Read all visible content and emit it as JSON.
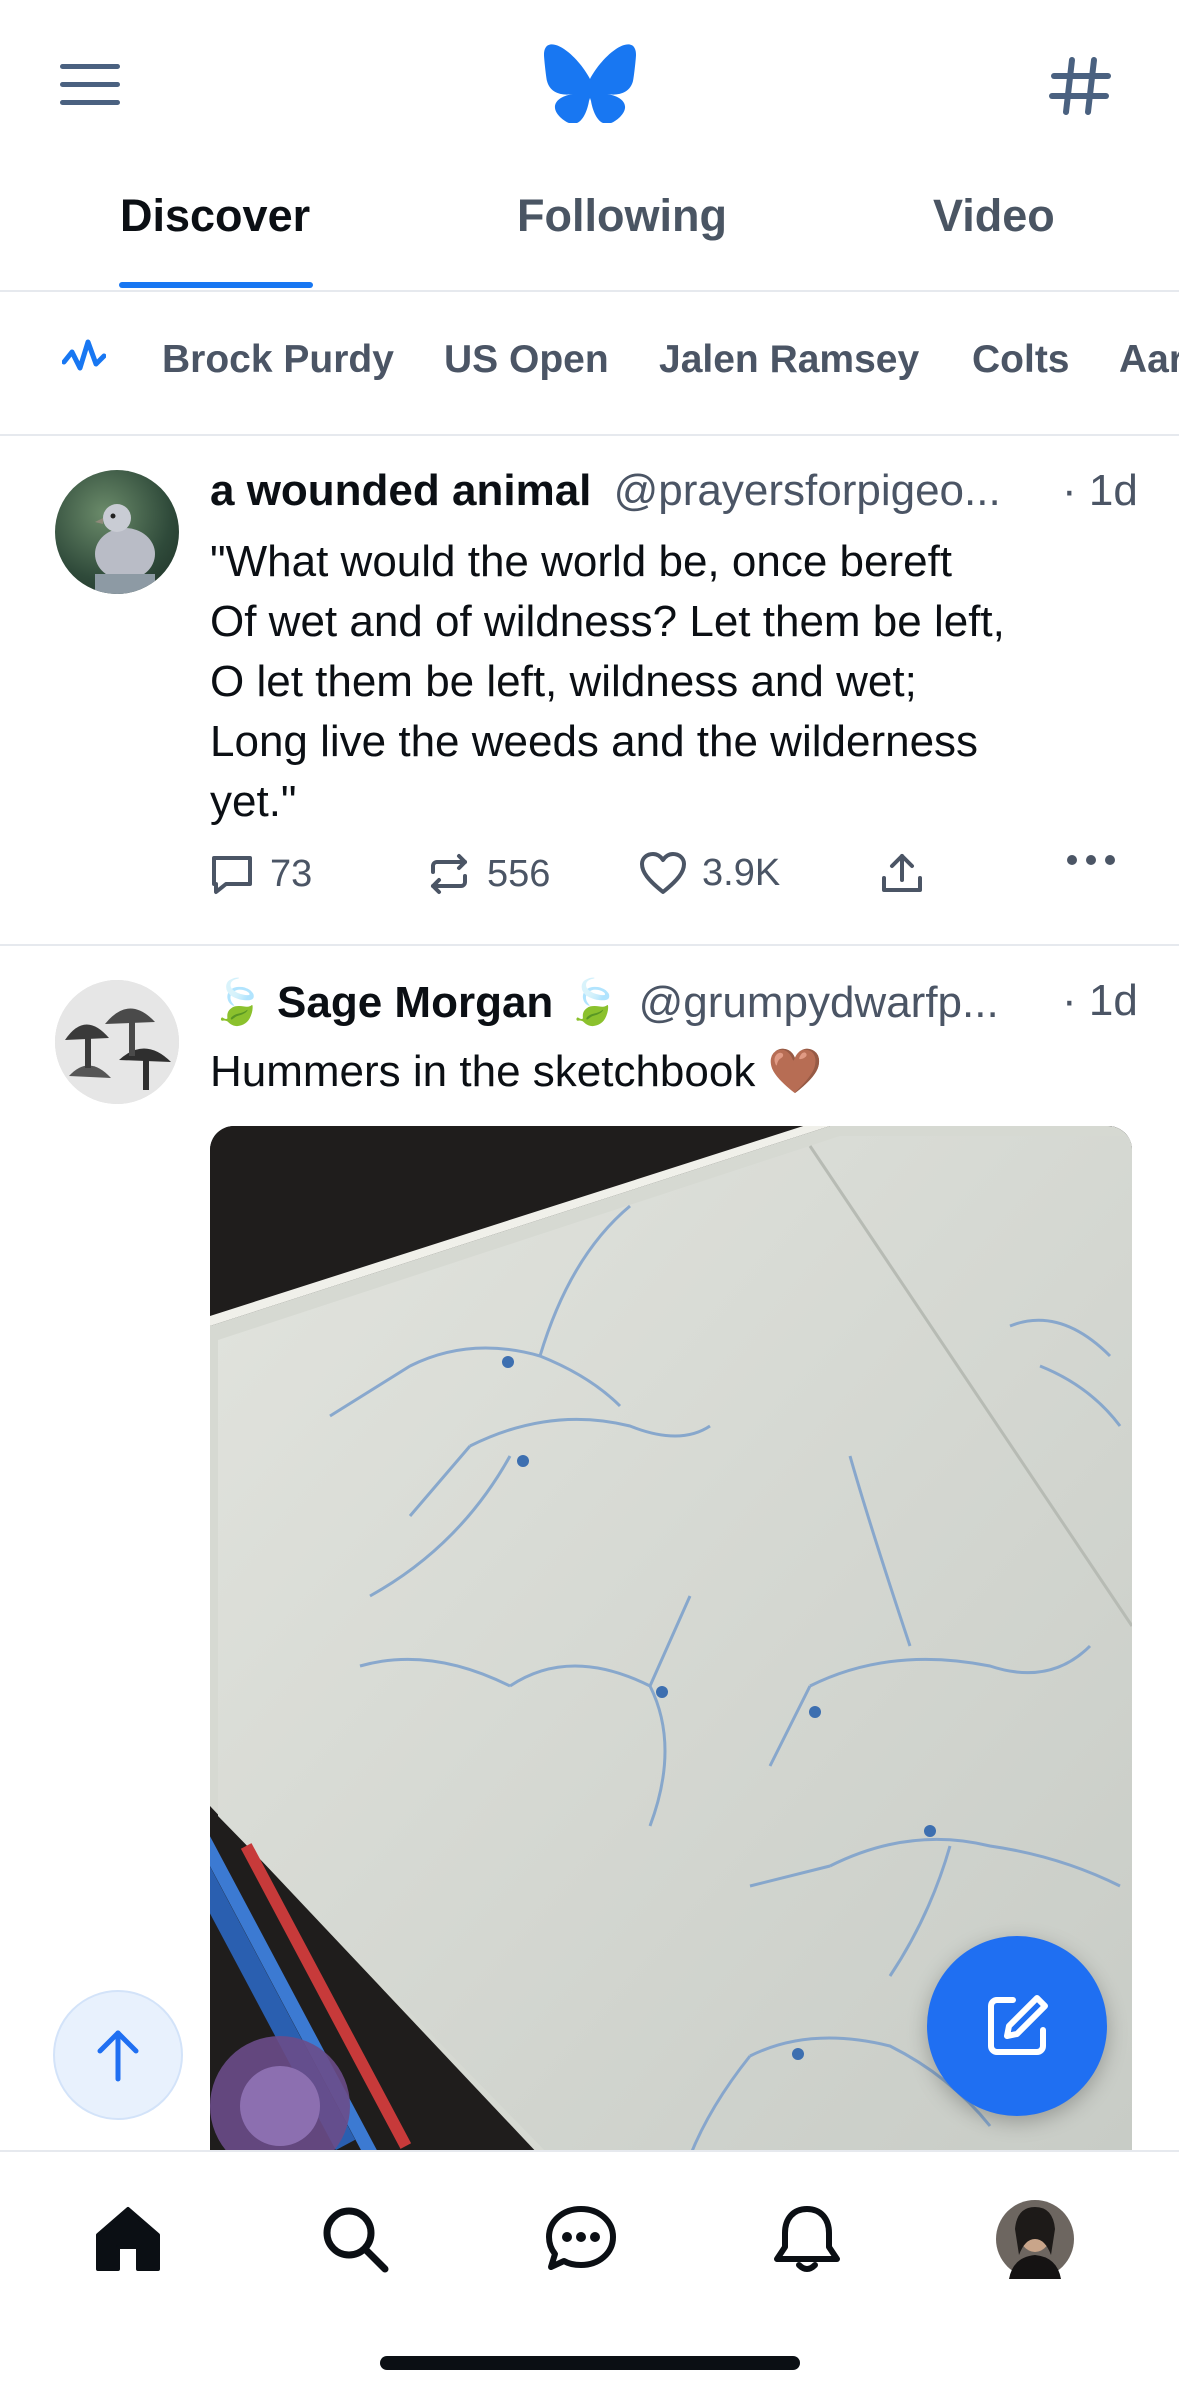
{
  "header": {
    "menu_icon": "hamburger-menu-icon",
    "logo_icon": "butterfly-logo-icon",
    "feeds_icon": "hashtag-icon",
    "brand_color": "#1877f2"
  },
  "tabs": [
    {
      "label": "Discover",
      "active": true
    },
    {
      "label": "Following",
      "active": false
    },
    {
      "label": "Video",
      "active": false
    }
  ],
  "trending": {
    "icon": "trending-pulse-icon",
    "items": [
      "Brock Purdy",
      "US Open",
      "Jalen Ramsey",
      "Colts",
      "Aar"
    ]
  },
  "posts": [
    {
      "author": "a wounded animal",
      "handle": "@prayersforpigeo...",
      "time": "· 1d",
      "text_lines": [
        "\"What would the world be, once bereft",
        "Of wet and of wildness? Let them be left,",
        "O let them be left, wildness and wet;",
        "Long live the weeds and the wilderness",
        "yet.\""
      ],
      "replies": "73",
      "reposts": "556",
      "likes": "3.9K"
    },
    {
      "author_prefix": "🍃",
      "author": "Sage Morgan",
      "author_suffix": "🍃",
      "handle": "@grumpydwarfp...",
      "time": "· 1d",
      "text": "Hummers in the sketchbook 🤎",
      "image_alt": "sketchbook-with-hummingbird-drawings"
    }
  ],
  "bottom_nav": [
    "home-icon",
    "search-icon",
    "chat-icon",
    "notifications-bell-icon",
    "profile-avatar"
  ],
  "fab_icon": "compose-icon",
  "scroll_top_icon": "arrow-up-icon"
}
